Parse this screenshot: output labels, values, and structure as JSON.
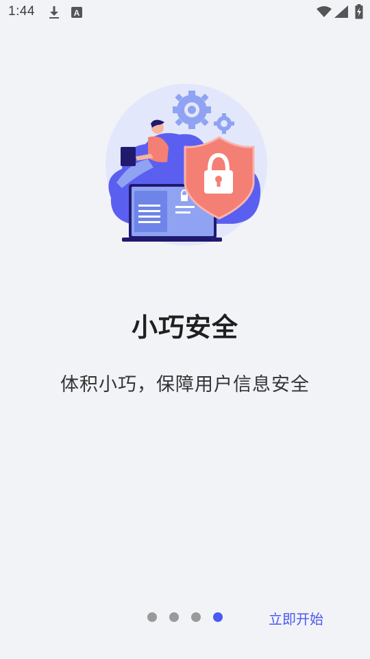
{
  "status_bar": {
    "time": "1:44",
    "icons": [
      "download-icon",
      "font-a-icon",
      "wifi-icon",
      "signal-icon",
      "battery-icon"
    ]
  },
  "onboarding": {
    "title": "小巧安全",
    "subtitle": "体积小巧，保障用户信息安全",
    "page_count": 4,
    "current_page": 4
  },
  "actions": {
    "start_label": "立即开始"
  },
  "colors": {
    "background": "#f2f3f7",
    "accent": "#4a5af0",
    "dot_inactive": "#9a9a9a",
    "shield": "#f47f74"
  }
}
